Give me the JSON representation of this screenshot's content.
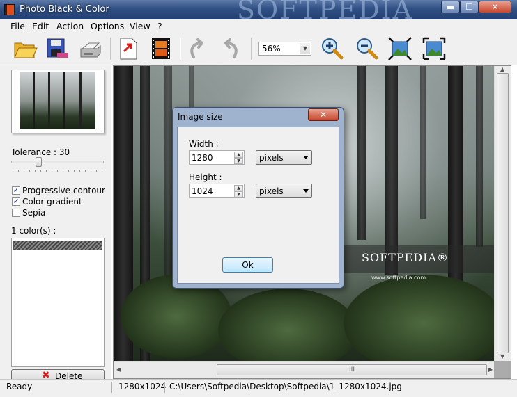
{
  "window": {
    "title": "Photo Black & Color",
    "watermark": "SOFTPEDIA",
    "min_glyph": "▬",
    "max_glyph": "☐",
    "close_glyph": "✕"
  },
  "menu": [
    "File",
    "Edit",
    "Action",
    "Options",
    "View",
    "?"
  ],
  "toolbar": {
    "icons": [
      "open-folder-icon",
      "save-icon",
      "print-icon",
      "export-icon",
      "film-icon",
      "undo-icon",
      "redo-icon",
      "zoom-in-icon",
      "zoom-out-icon",
      "fit-image-icon",
      "actual-size-icon"
    ],
    "zoom_value": "56%"
  },
  "left_panel": {
    "tolerance_label": "Tolerance : 30",
    "tolerance_value": 30,
    "checkboxes": [
      {
        "label": "Progressive contour",
        "checked": true
      },
      {
        "label": "Color gradient",
        "checked": true
      },
      {
        "label": "Sepia",
        "checked": false
      }
    ],
    "colors_label": "1 color(s) :",
    "delete_label": "Delete"
  },
  "canvas": {
    "logo_text": "SOFTPEDIA®",
    "logo_url": "www.softpedia.com",
    "hscroll_grip": "III"
  },
  "dialog": {
    "title": "Image size",
    "close_glyph": "✕",
    "width_label": "Width :",
    "width_value": "1280",
    "width_unit": "pixels",
    "height_label": "Height :",
    "height_value": "1024",
    "height_unit": "pixels",
    "ok_label": "Ok"
  },
  "status": {
    "state": "Ready",
    "dimensions": "1280x1024",
    "path": "C:\\Users\\Softpedia\\Desktop\\Softpedia\\1_1280x1024.jpg"
  }
}
